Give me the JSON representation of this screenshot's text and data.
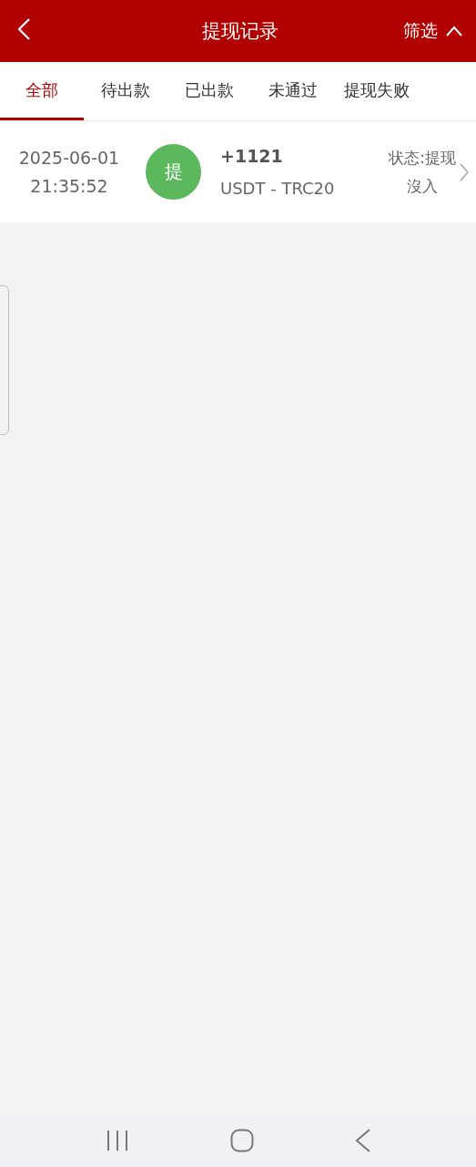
{
  "header": {
    "title": "提现记录",
    "filter": "筛选"
  },
  "tabs": [
    {
      "label": "全部",
      "selected": true
    },
    {
      "label": "待出款",
      "selected": false
    },
    {
      "label": "已出款",
      "selected": false
    },
    {
      "label": "未通过",
      "selected": false
    },
    {
      "label": "提现失败",
      "selected": false
    }
  ],
  "records": [
    {
      "date": "2025-06-01",
      "time": "21:35:52",
      "badge": "提",
      "amount": "+1121",
      "currency": "USDT - TRC20",
      "status_lines": [
        "状态:提现",
        "沒入"
      ]
    }
  ]
}
